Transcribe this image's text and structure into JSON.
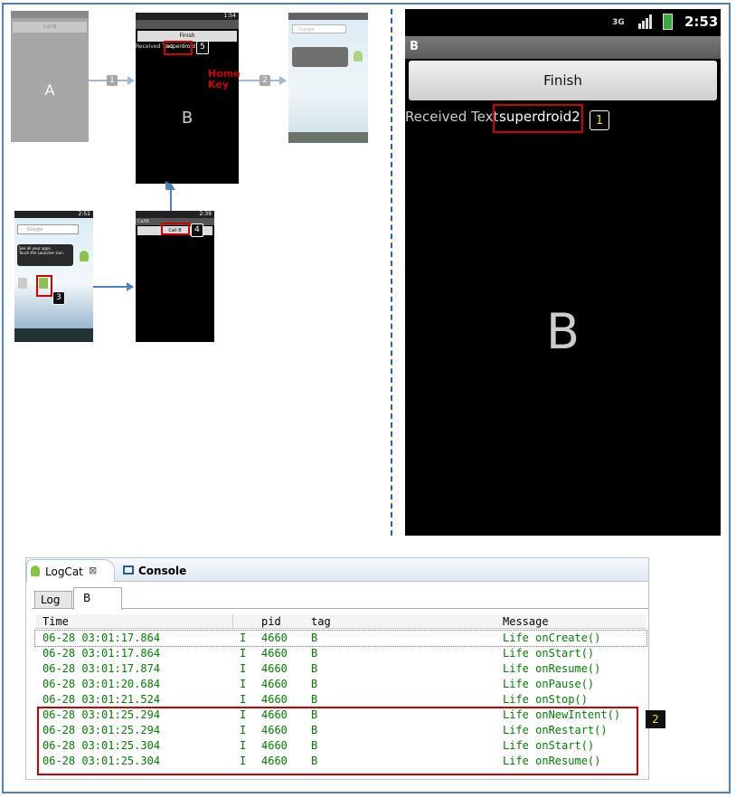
{
  "top_left_diagram": {
    "screen_a_letter": "A",
    "screen_a_button": "Call B",
    "screen_b_button": "Finish",
    "screen_b_received_label": "Received Text",
    "screen_b_received_value": "superdroid",
    "screen_b_letter": "B",
    "screen_b_time": "1:54",
    "home_key_label": "Home\nKey",
    "search_placeholder": "Google",
    "tooltip_title": "See all your apps.",
    "tooltip_body": "Touch the Launcher icon.",
    "callb_title": "CallB",
    "callb_button": "Call B",
    "callb_time": "2:39",
    "launcher_time": "2:51",
    "steps": [
      "1",
      "2",
      "3",
      "4",
      "5"
    ]
  },
  "phone": {
    "status_time": "2:53",
    "network": "3G",
    "title": "B",
    "finish_button": "Finish",
    "received_label": "Received Text",
    "received_value": "superdroid2",
    "step_badge": "1",
    "big_letter": "B"
  },
  "logcat": {
    "tabs": [
      {
        "label": "LogCat",
        "close": "⊠"
      },
      {
        "label": "Console"
      }
    ],
    "filter_tabs": [
      "Log",
      "B"
    ],
    "columns": [
      "Time",
      "",
      "pid",
      "tag",
      "Message"
    ],
    "rows": [
      [
        "06-28 03:01:17.864",
        "I",
        "4660",
        "B",
        "Life onCreate()"
      ],
      [
        "06-28 03:01:17.864",
        "I",
        "4660",
        "B",
        "Life onStart()"
      ],
      [
        "06-28 03:01:17.874",
        "I",
        "4660",
        "B",
        "Life onResume()"
      ],
      [
        "06-28 03:01:20.684",
        "I",
        "4660",
        "B",
        "Life onPause()"
      ],
      [
        "06-28 03:01:21.524",
        "I",
        "4660",
        "B",
        "Life onStop()"
      ],
      [
        "06-28 03:01:25.294",
        "I",
        "4660",
        "B",
        "Life onNewIntent()"
      ],
      [
        "06-28 03:01:25.294",
        "I",
        "4660",
        "B",
        "Life onRestart()"
      ],
      [
        "06-28 03:01:25.304",
        "I",
        "4660",
        "B",
        "Life onStart()"
      ],
      [
        "06-28 03:01:25.304",
        "I",
        "4660",
        "B",
        "Life onResume()"
      ]
    ],
    "highlight_badge": "2"
  },
  "colors": {
    "frame": "#4f81bd",
    "highlight": "#d00000",
    "log_text": "#008000"
  }
}
